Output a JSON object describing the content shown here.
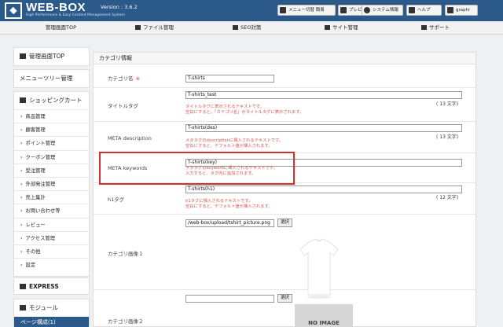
{
  "header": {
    "logo": "WEB-BOX",
    "subtitle": "High Performance & Easy Content Management System",
    "version": "Version : 3.6.2",
    "buttons": {
      "menu": "メニュー切替 簡易",
      "preview": "プレビュー",
      "system": "システム情報",
      "help": "ヘルプ",
      "user": "graphi"
    }
  },
  "nav": {
    "items": [
      "管理画面TOP",
      "ファイル管理",
      "SEO対策",
      "サイト管理",
      "サポート"
    ]
  },
  "sidebar": {
    "top": "管理画面TOP",
    "menu_tree": "メニューツリー管理",
    "cart": "ショッピングカート",
    "items": [
      "商品管理",
      "顧客管理",
      "ポイント管理",
      "クーポン管理",
      "受注管理",
      "外部発注管理",
      "売上集計",
      "お問い合わせ等",
      "レビュー",
      "アクセス管理",
      "その他",
      "設定"
    ],
    "express": "EXPRESS",
    "module": "モジュール",
    "active": "ページ構成(1)"
  },
  "panel": {
    "title": "カテゴリ情報",
    "required_mark": "※",
    "fields": {
      "name": {
        "label": "カテゴリ名",
        "value": "T-shirts"
      },
      "title_tag": {
        "label": "タイトルタグ",
        "value": "T-shirts_test",
        "count": "( 13 文字)",
        "help1": "タイトルタグに表示されるテキストです。",
        "help2": "空白にすると、「カテゴリ名」がタイトルタグに表示されます。"
      },
      "meta_description": {
        "label": "META description",
        "value": "T-shirts(des)",
        "count": "( 13 文字)",
        "help1": "メタタグのdescriptionに挿入されるテキストです。",
        "help2": "空白にすると、デフォルト値が挿入されます。"
      },
      "meta_keywords": {
        "label": "META keywords",
        "value": "T-shirts(key)",
        "help1": "メタタグのkeywordに挿入されるテキストです。",
        "help2": "入力すると、タグ内に追加されます。"
      },
      "h1_tag": {
        "label": "h1タグ",
        "value": "T-shirts(h1)",
        "count": "( 12 文字)",
        "help1": "h1タグに挿入されるテキストです。",
        "help2": "空白にすると、デフォルト値が挿入されます。"
      },
      "image1": {
        "label": "カテゴリ画像１",
        "value": "/web-box/upload/tshirt_picture.png",
        "button": "選択"
      },
      "image2": {
        "label": "カテゴリ画像２",
        "value": "",
        "button": "選択",
        "placeholder_image": "NO IMAGE"
      }
    }
  },
  "colors": {
    "header_bg": "#2b5a8a",
    "help_text": "#d9534f",
    "highlight": "#d32f2f"
  }
}
